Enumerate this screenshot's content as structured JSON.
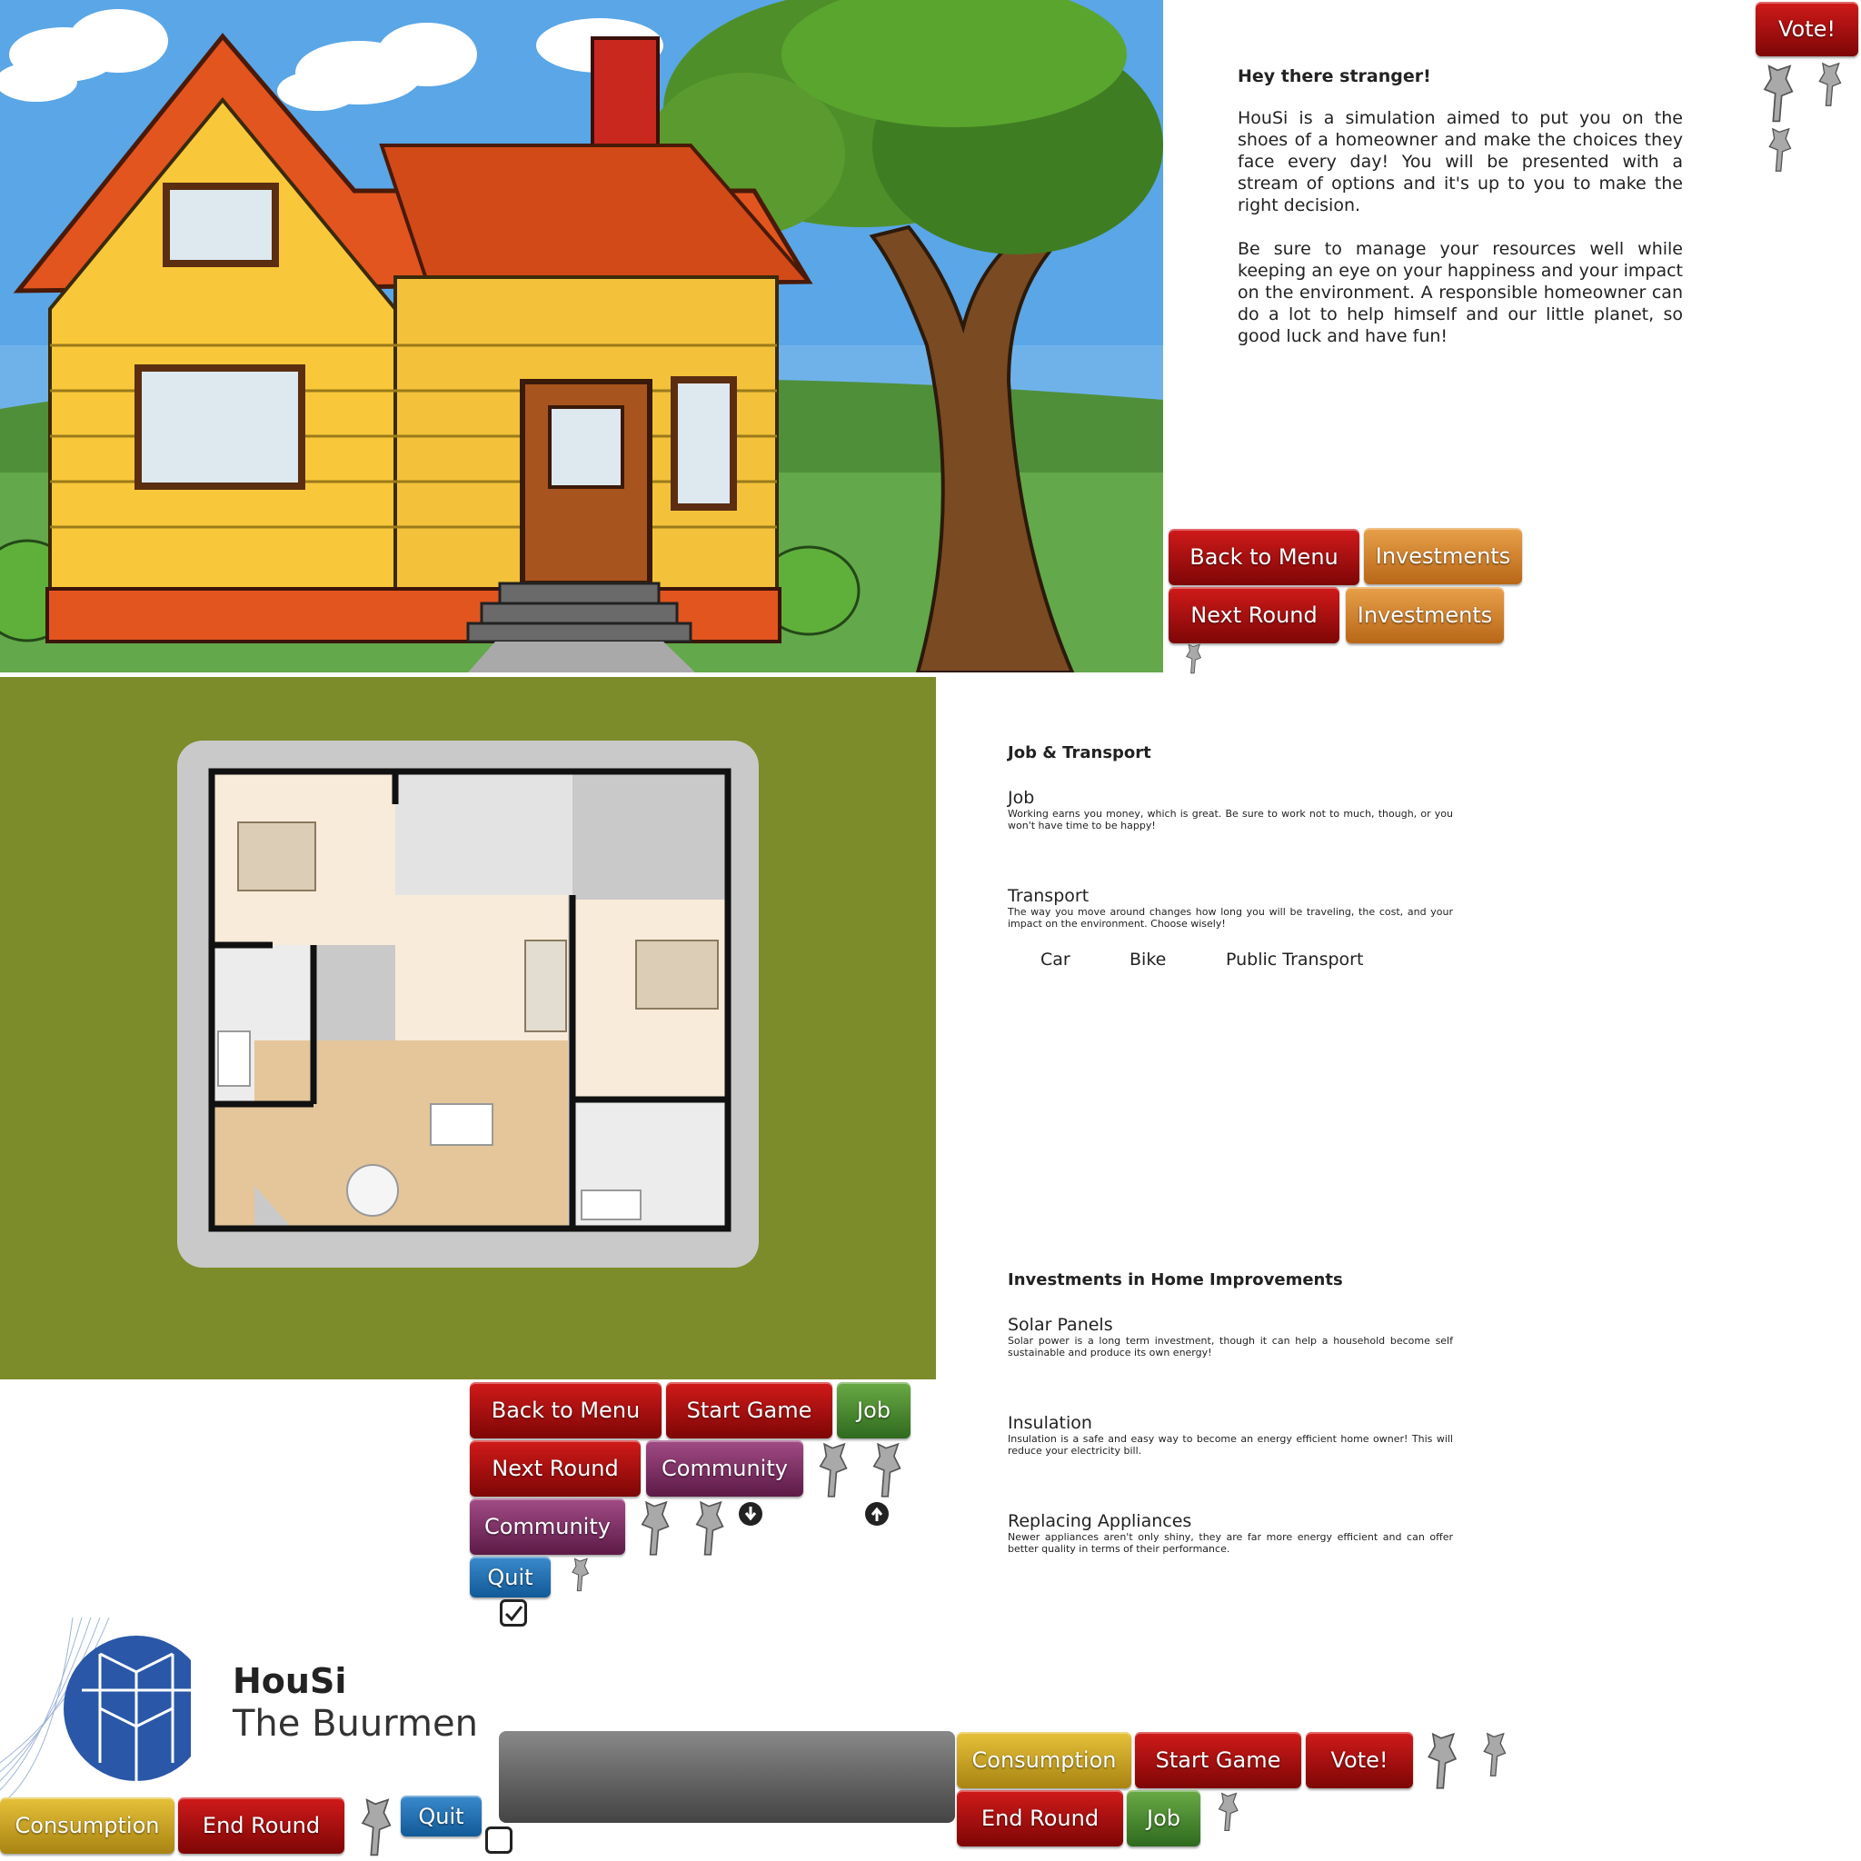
{
  "welcome": {
    "heading": "Hey there stranger!",
    "para1": "HouSi is a simulation aimed to put you on the shoes of a homeowner and make the choices they face every day! You will be presented with a stream of options and it's up to you to make the right decision.",
    "para2": "Be sure to manage your resources well while keeping an eye on your happiness and your impact on the environment. A responsible homeowner can do a lot to help himself and our little planet, so good luck and have fun!"
  },
  "job_transport": {
    "heading": "Job & Transport",
    "job_title": "Job",
    "job_desc": "Working earns you money, which is great. Be sure to work not to much, though, or you won't have time to be happy!",
    "transport_title": "Transport",
    "transport_desc": "The way you move around changes how long you will be traveling, the cost, and your impact on the environment. Choose wisely!",
    "options": [
      "Car",
      "Bike",
      "Public Transport"
    ]
  },
  "investments": {
    "heading": "Investments in Home Improvements",
    "solar_title": "Solar Panels",
    "solar_desc": "Solar power is a long term investment, though it can help a household become self sustainable and produce its own energy!",
    "insulation_title": "Insulation",
    "insulation_desc": "Insulation is a safe and easy way to become an energy efficient home owner! This will reduce your electricity bill.",
    "appliances_title": "Replacing Appliances",
    "appliances_desc": "Newer appliances aren't only shiny, they are far more energy efficient and can offer better quality in terms of their performance."
  },
  "buttons": {
    "vote": "Vote!",
    "back_to_menu": "Back to Menu",
    "investments": "Investments",
    "next_round": "Next Round",
    "start_game": "Start Game",
    "job": "Job",
    "community": "Community",
    "quit": "Quit",
    "consumption": "Consumption",
    "end_round": "End Round"
  },
  "branding": {
    "title": "HouSi",
    "subtitle": "The Buurmen"
  },
  "colors": {
    "red": "#b01010",
    "orange": "#d0852f",
    "green": "#4d8a33",
    "purple": "#7d3265",
    "blue": "#2272b4",
    "yellow": "#c9a222"
  }
}
